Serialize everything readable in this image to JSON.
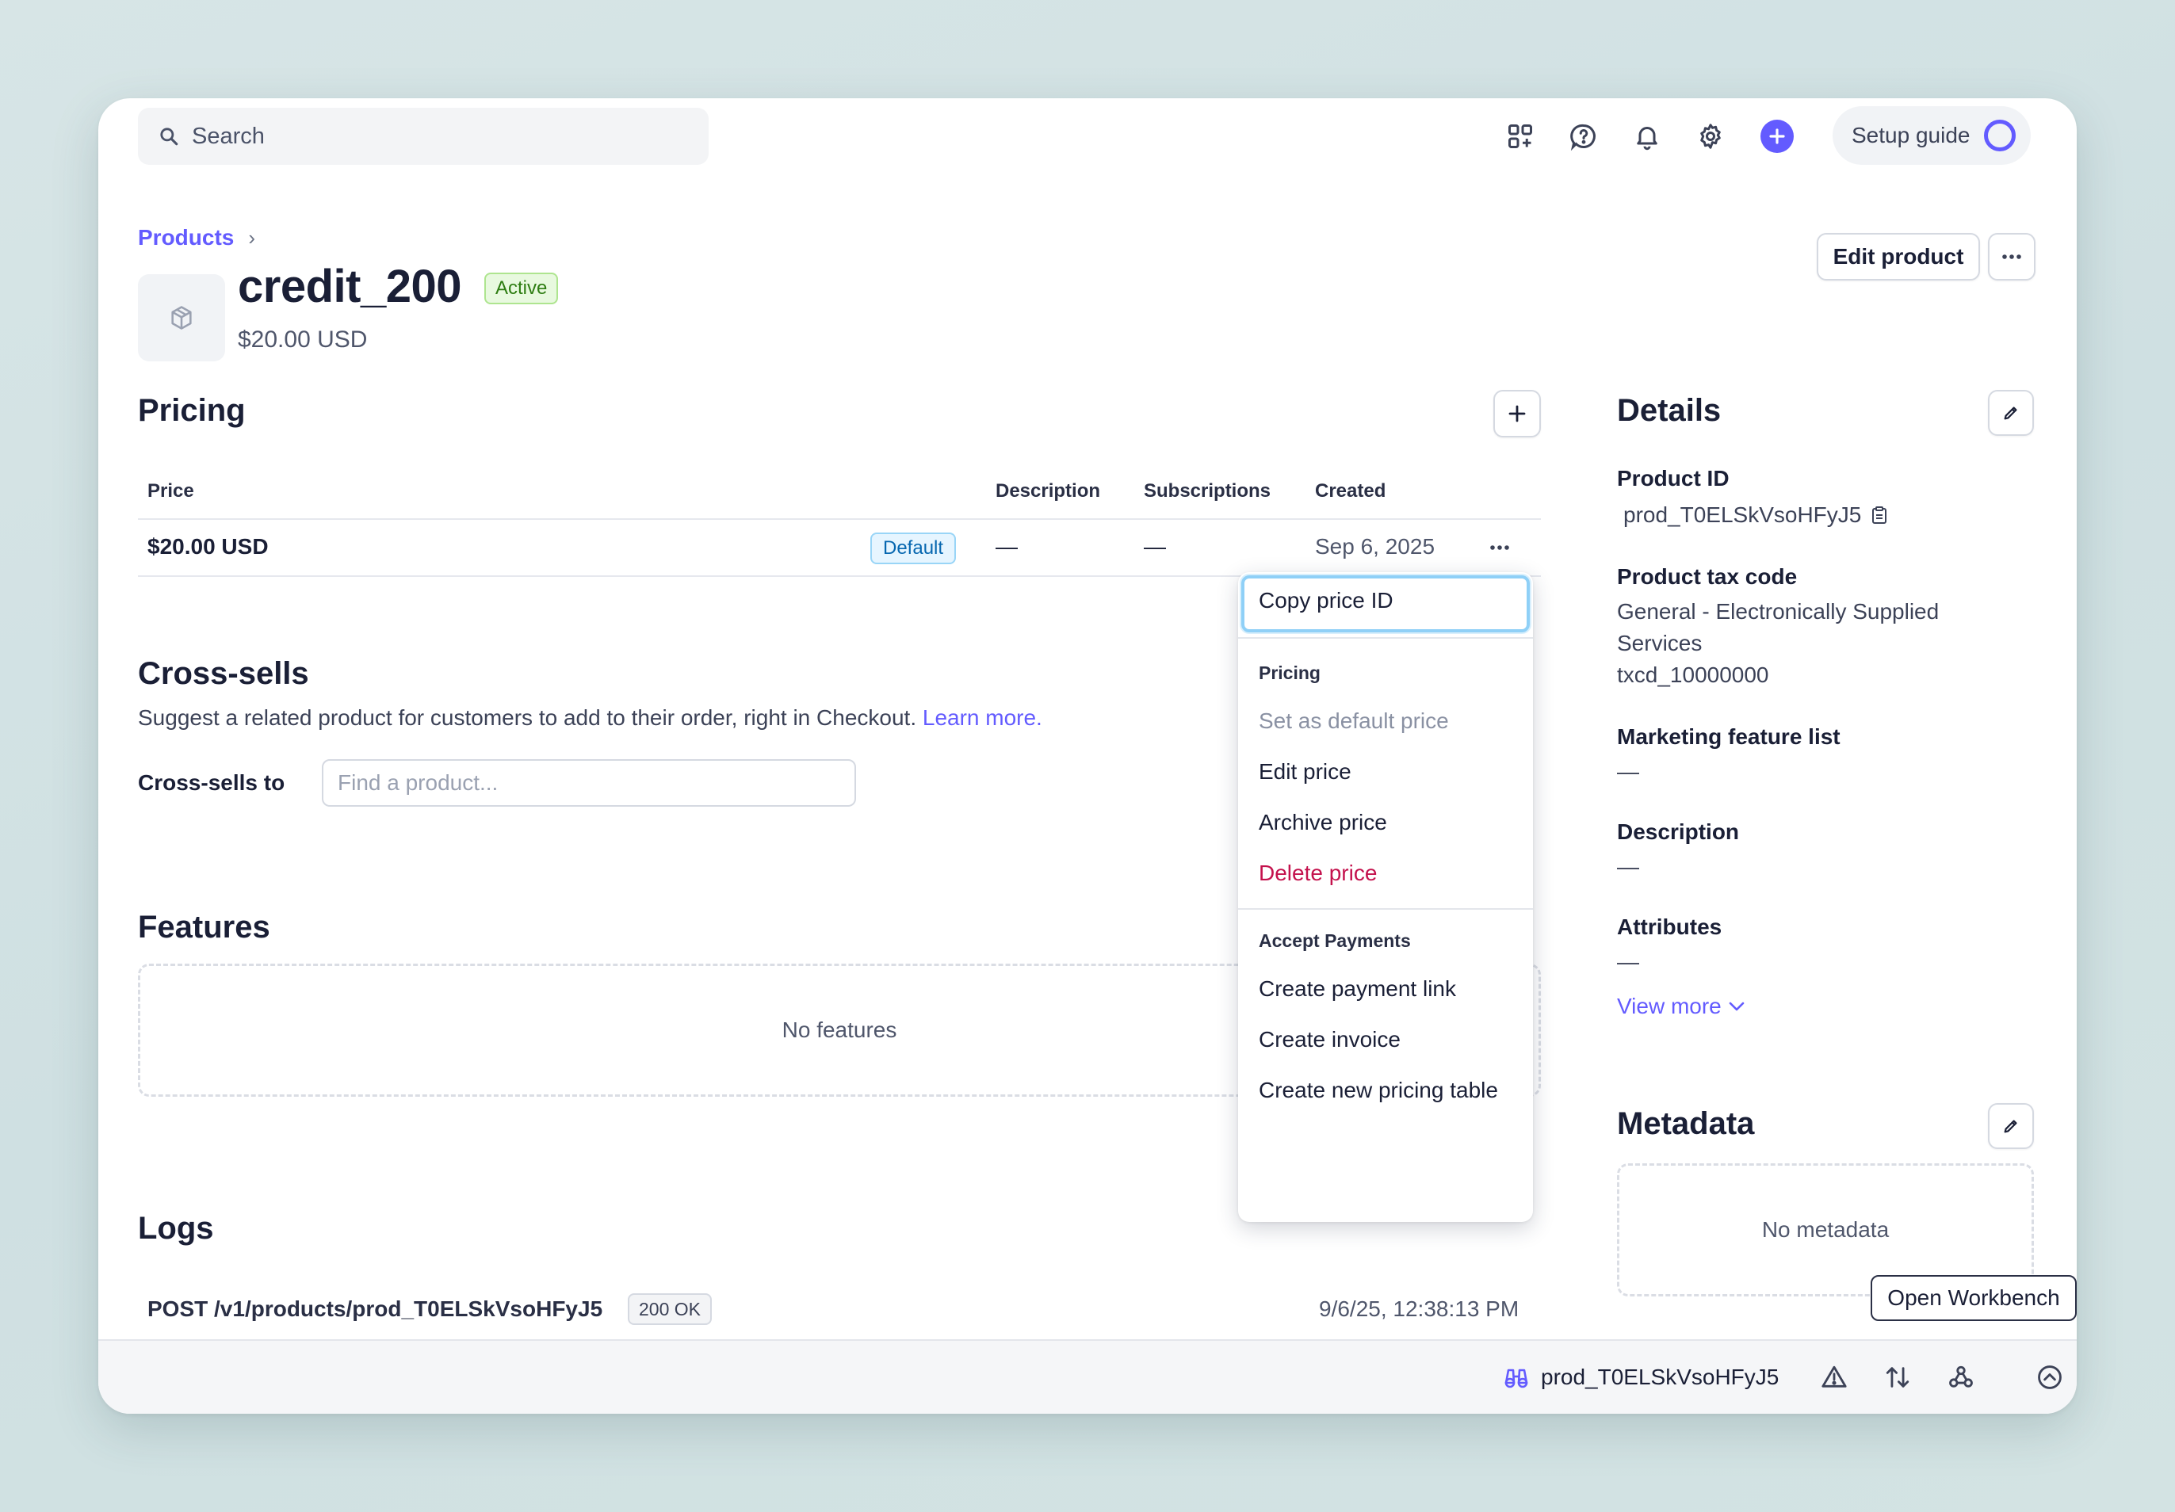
{
  "topbar": {
    "search_placeholder": "Search",
    "setup_guide_label": "Setup guide",
    "icons": [
      "apps-icon",
      "help-icon",
      "bell-icon",
      "gear-icon",
      "plus-icon"
    ]
  },
  "header": {
    "breadcrumb": "Products",
    "title": "credit_200",
    "status": "Active",
    "price": "$20.00 USD",
    "edit_button": "Edit product"
  },
  "pricing": {
    "heading": "Pricing",
    "columns": [
      "Price",
      "Description",
      "Subscriptions",
      "Created"
    ],
    "rows": [
      {
        "price": "$20.00 USD",
        "badge": "Default",
        "description": "—",
        "subscriptions": "—",
        "created": "Sep 6, 2025"
      }
    ]
  },
  "menu": {
    "copy_price_id": "Copy price ID",
    "pricing_heading": "Pricing",
    "set_default": "Set as default price",
    "edit_price": "Edit price",
    "archive_price": "Archive price",
    "delete_price": "Delete price",
    "accept_heading": "Accept Payments",
    "create_link": "Create payment link",
    "create_invoice": "Create invoice",
    "create_table": "Create new pricing table"
  },
  "cross_sells": {
    "heading": "Cross-sells",
    "description": "Suggest a related product for customers to add to their order, right in Checkout.",
    "learn_more": "Learn more.",
    "label": "Cross-sells to",
    "placeholder": "Find a product..."
  },
  "features": {
    "heading": "Features",
    "empty": "No features"
  },
  "logs": {
    "heading": "Logs",
    "entries": [
      {
        "request": "POST /v1/products/prod_T0ELSkVsoHFyJ5",
        "status": "200 OK",
        "time": "9/6/25, 12:38:13 PM"
      }
    ]
  },
  "details": {
    "heading": "Details",
    "product_id_label": "Product ID",
    "product_id": "prod_T0ELSkVsoHFyJ5",
    "tax_code_label": "Product tax code",
    "tax_code_line1": "General - Electronically Supplied",
    "tax_code_line2": "Services",
    "tax_code_id": "txcd_10000000",
    "marketing_label": "Marketing feature list",
    "marketing_value": "—",
    "description_label": "Description",
    "description_value": "—",
    "attributes_label": "Attributes",
    "attributes_value": "—",
    "view_more": "View more"
  },
  "metadata": {
    "heading": "Metadata",
    "empty": "No metadata"
  },
  "bottom_bar": {
    "object_id": "prod_T0ELSkVsoHFyJ5",
    "workbench_label": "Open Workbench"
  },
  "colors": {
    "accent": "#635bff",
    "active_badge_bg": "#e8f9df",
    "default_badge_bg": "#e6f5ff",
    "danger": "#c4124d"
  }
}
